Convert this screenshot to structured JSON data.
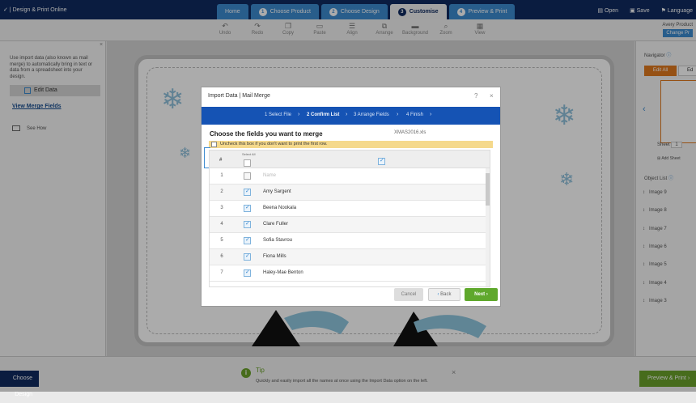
{
  "app": {
    "brand": "Design & Print Online"
  },
  "tabs": [
    {
      "num": "",
      "label": "Home"
    },
    {
      "num": "1",
      "label": "Choose Product"
    },
    {
      "num": "2",
      "label": "Choose Design"
    },
    {
      "num": "3",
      "label": "Customise"
    },
    {
      "num": "4",
      "label": "Preview & Print"
    }
  ],
  "topright": {
    "open": "Open",
    "save": "Save",
    "language": "Language"
  },
  "toolbar": {
    "items": [
      "Undo",
      "Redo",
      "Copy",
      "Paste",
      "Align",
      "Arrange",
      "Background",
      "Zoom",
      "View"
    ],
    "product": "Avery Product",
    "change_product": "Change Pr"
  },
  "leftpanel": {
    "description": "Use import data (also known as mail merge) to automatically bring in text or data from a spreadsheet into your design.",
    "edit_data": "Edit Data",
    "view_merge_fields": "View Merge Fields",
    "see_how": "See How"
  },
  "rightpanel": {
    "navigator": "Navigator",
    "edit_all": "Edit All",
    "edit_other": "Ed",
    "sheet_label": "Sheet",
    "sheet_value": "1",
    "add_sheet": "Add Sheet",
    "object_list": "Object List",
    "objects": [
      "Image 9",
      "Image 8",
      "Image 7",
      "Image 6",
      "Image 5",
      "Image 4",
      "Image 3"
    ]
  },
  "bottom": {
    "choose_design": "Choose Design",
    "preview_print": "Preview & Print",
    "tip_title": "Tip",
    "tip_text": "Quickly and easily import all the names at once using the Import Data option on the left."
  },
  "modal": {
    "title": "Import Data | Mail Merge",
    "steps": [
      "1 Select File",
      "2 Confirm List",
      "3 Arrange Fields",
      "4 Finish"
    ],
    "heading": "Choose the fields you want to merge",
    "filename": "XMAS2016.xls",
    "warning": "Uncheck this box if you don't want to print the first row.",
    "col_hash": "#",
    "col_select": "Select All",
    "rows": [
      {
        "n": "1",
        "checked": false,
        "name": "Name"
      },
      {
        "n": "2",
        "checked": true,
        "name": "Amy Sargent"
      },
      {
        "n": "3",
        "checked": true,
        "name": "Beena Nookala"
      },
      {
        "n": "4",
        "checked": true,
        "name": "Clare Fuller"
      },
      {
        "n": "5",
        "checked": true,
        "name": "Sofia Stavrou"
      },
      {
        "n": "6",
        "checked": true,
        "name": "Fiona Mills"
      },
      {
        "n": "7",
        "checked": true,
        "name": "Haley-Mae Benton"
      }
    ],
    "cancel": "Cancel",
    "back": "Back",
    "next": "Next"
  },
  "colors": {
    "navy": "#0f2b60",
    "blue": "#1553b4",
    "green": "#5fa82c",
    "orange": "#e07a1f"
  }
}
